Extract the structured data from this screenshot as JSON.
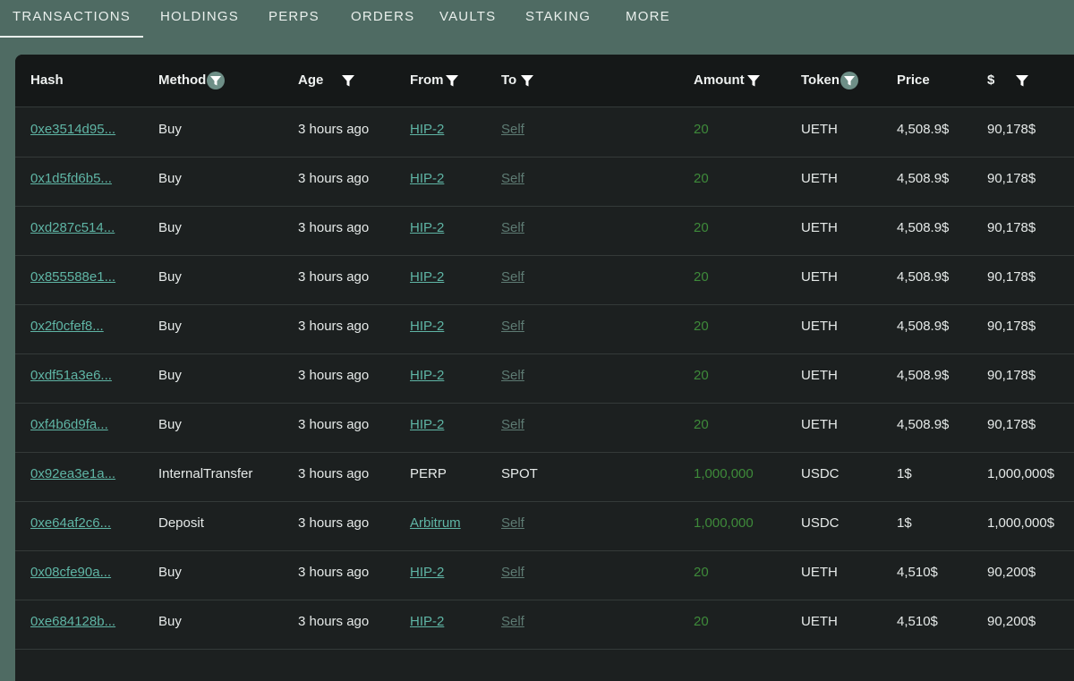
{
  "tabs": [
    {
      "label": "TRANSACTIONS",
      "active": true
    },
    {
      "label": "HOLDINGS"
    },
    {
      "label": "PERPS"
    },
    {
      "label": "ORDERS"
    },
    {
      "label": "VAULTS"
    },
    {
      "label": "STAKING"
    },
    {
      "label": "MORE"
    }
  ],
  "columns": {
    "hash": "Hash",
    "method": "Method",
    "age": "Age",
    "from": "From",
    "to": "To",
    "amount": "Amount",
    "token": "Token",
    "price": "Price",
    "usd": "$"
  },
  "rows": [
    {
      "hash": "0xe3514d95...",
      "method": "Buy",
      "age": "3 hours ago",
      "from": "HIP-2",
      "to": "Self",
      "amount": "20",
      "token": "UETH",
      "price": "4,508.9$",
      "usd": "90,178$"
    },
    {
      "hash": "0x1d5fd6b5...",
      "method": "Buy",
      "age": "3 hours ago",
      "from": "HIP-2",
      "to": "Self",
      "amount": "20",
      "token": "UETH",
      "price": "4,508.9$",
      "usd": "90,178$"
    },
    {
      "hash": "0xd287c514...",
      "method": "Buy",
      "age": "3 hours ago",
      "from": "HIP-2",
      "to": "Self",
      "amount": "20",
      "token": "UETH",
      "price": "4,508.9$",
      "usd": "90,178$"
    },
    {
      "hash": "0x855588e1...",
      "method": "Buy",
      "age": "3 hours ago",
      "from": "HIP-2",
      "to": "Self",
      "amount": "20",
      "token": "UETH",
      "price": "4,508.9$",
      "usd": "90,178$"
    },
    {
      "hash": "0x2f0cfef8...",
      "method": "Buy",
      "age": "3 hours ago",
      "from": "HIP-2",
      "to": "Self",
      "amount": "20",
      "token": "UETH",
      "price": "4,508.9$",
      "usd": "90,178$"
    },
    {
      "hash": "0xdf51a3e6...",
      "method": "Buy",
      "age": "3 hours ago",
      "from": "HIP-2",
      "to": "Self",
      "amount": "20",
      "token": "UETH",
      "price": "4,508.9$",
      "usd": "90,178$"
    },
    {
      "hash": "0xf4b6d9fa...",
      "method": "Buy",
      "age": "3 hours ago",
      "from": "HIP-2",
      "to": "Self",
      "amount": "20",
      "token": "UETH",
      "price": "4,508.9$",
      "usd": "90,178$"
    },
    {
      "hash": "0x92ea3e1a...",
      "method": "InternalTransfer",
      "age": "3 hours ago",
      "from": "PERP",
      "to": "SPOT",
      "amount": "1,000,000",
      "token": "USDC",
      "price": "1$",
      "usd": "1,000,000$",
      "from_plain": true,
      "to_plain": true
    },
    {
      "hash": "0xe64af2c6...",
      "method": "Deposit",
      "age": "3 hours ago",
      "from": "Arbitrum",
      "to": "Self",
      "amount": "1,000,000",
      "token": "USDC",
      "price": "1$",
      "usd": "1,000,000$"
    },
    {
      "hash": "0x08cfe90a...",
      "method": "Buy",
      "age": "3 hours ago",
      "from": "HIP-2",
      "to": "Self",
      "amount": "20",
      "token": "UETH",
      "price": "4,510$",
      "usd": "90,200$"
    },
    {
      "hash": "0xe684128b...",
      "method": "Buy",
      "age": "3 hours ago",
      "from": "HIP-2",
      "to": "Self",
      "amount": "20",
      "token": "UETH",
      "price": "4,510$",
      "usd": "90,200$"
    }
  ],
  "colors": {
    "background": "#4f6b63",
    "panel": "#1c2020",
    "link": "#5fb5a5",
    "self_link": "#5e7b73",
    "amount": "#3e8a3a"
  }
}
